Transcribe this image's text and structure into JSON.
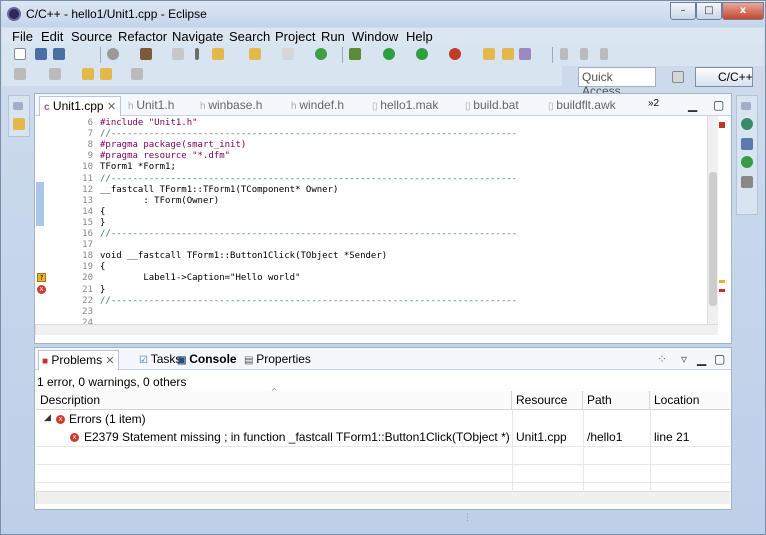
{
  "window": {
    "title": "C/C++ - hello1/Unit1.cpp - Eclipse",
    "min": "–",
    "max": "□",
    "close": "x"
  },
  "menu": [
    "File",
    "Edit",
    "Source",
    "Refactor",
    "Navigate",
    "Search",
    "Project",
    "Run",
    "Window",
    "Help"
  ],
  "quick_access": {
    "placeholder": "Quick Access"
  },
  "perspective": "C/C++",
  "editor": {
    "tabs": [
      {
        "label": "Unit1.cpp",
        "active": true
      },
      {
        "label": "Unit1.h"
      },
      {
        "label": "winbase.h"
      },
      {
        "label": "windef.h"
      },
      {
        "label": "hello1.mak"
      },
      {
        "label": "build.bat"
      },
      {
        "label": "buildflt.awk"
      }
    ],
    "overflow": "»2",
    "lines": [
      {
        "n": "6",
        "t": "#include \"Unit1.h\""
      },
      {
        "n": "7",
        "t": "//---------------------------------------------------------------------------"
      },
      {
        "n": "8",
        "t": "#pragma package(smart_init)"
      },
      {
        "n": "9",
        "t": "#pragma resource \"*.dfm\""
      },
      {
        "n": "10",
        "t": "TForm1 *Form1;"
      },
      {
        "n": "11",
        "t": "//---------------------------------------------------------------------------"
      },
      {
        "n": "12",
        "t": "__fastcall TForm1::TForm1(TComponent* Owner)"
      },
      {
        "n": "13",
        "t": "        : TForm(Owner)"
      },
      {
        "n": "14",
        "t": "{"
      },
      {
        "n": "15",
        "t": "}"
      },
      {
        "n": "16",
        "t": "//---------------------------------------------------------------------------"
      },
      {
        "n": "17",
        "t": ""
      },
      {
        "n": "18",
        "t": "void __fastcall TForm1::Button1Click(TObject *Sender)"
      },
      {
        "n": "19",
        "t": "{"
      },
      {
        "n": "20",
        "t": "        Label1->Caption=\"Hello world\""
      },
      {
        "n": "21",
        "t": "}"
      },
      {
        "n": "22",
        "t": "//---------------------------------------------------------------------------"
      },
      {
        "n": "23",
        "t": ""
      },
      {
        "n": "24",
        "t": ""
      }
    ]
  },
  "bottom": {
    "tabs": [
      {
        "label": "Problems",
        "active": true
      },
      {
        "label": "Tasks"
      },
      {
        "label": "Console"
      },
      {
        "label": "Properties"
      }
    ],
    "summary": "1 error, 0 warnings, 0 others",
    "columns": [
      "Description",
      "Resource",
      "Path",
      "Location"
    ],
    "group": "Errors (1 item)",
    "rows": [
      {
        "description": "E2379 Statement missing ; in function _fastcall TForm1::Button1Click(TObject *)",
        "resource": "Unit1.cpp",
        "path": "/hello1",
        "location": "line 21"
      }
    ]
  },
  "colors": {
    "accent": "#3a6ea5",
    "error": "#d03a2a",
    "comment": "#3f7f5f",
    "keyword": "#7f0055",
    "string": "#2a00ff"
  }
}
